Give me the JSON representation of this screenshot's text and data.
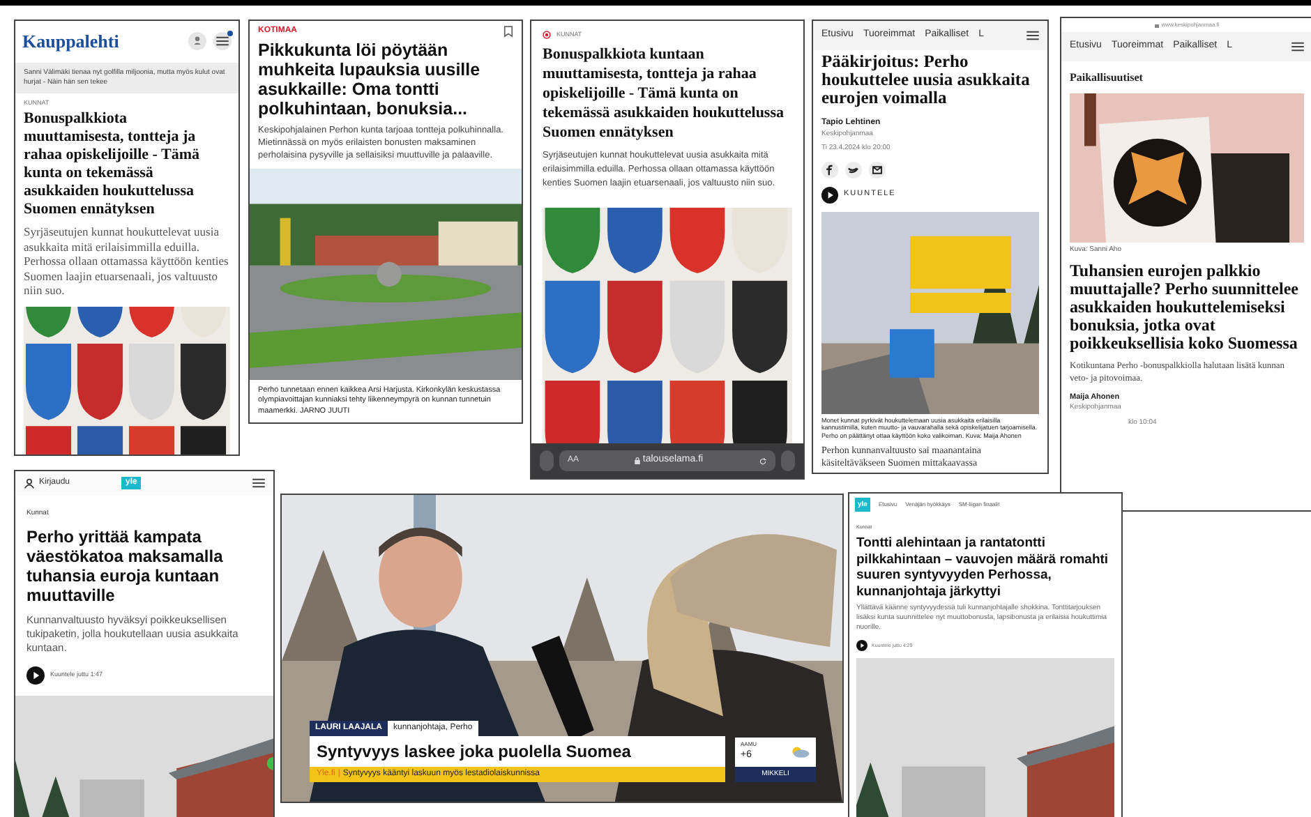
{
  "kauppalehti": {
    "logo": "Kauppalehti",
    "teaser": "Sanni Välimäki tienaa nyt golfilla miljoonia, mutta myös kulut ovat hurjat - Näin hän sen tekee",
    "tag": "KUNNAT",
    "headline": "Bonuspalkkiota muuttamisesta, tontteja ja rahaa opiskelijoille - Tämä kunta on tekemässä asukkaiden houkuttelussa Suomen ennätyksen",
    "lead": "Syrjäseutujen kunnat houkuttelevat uusia asukkaita mitä erilaisimmilla eduilla. Perhossa ollaan ottamassa käyttöön kenties Suomen laajin etuarsenaali, jos valtuusto niin suo."
  },
  "kotimaa": {
    "section": "KOTIMAA",
    "headline": "Pikkukunta löi pöytään muhkeita lupauksia uusille asukkaille: Oma tontti polkuhintaan, bonuksia...",
    "lead": "Keskipohjalainen Perhon kunta tarjoaa tontteja polkuhinnalla. Mietinnässä on myös erilaisten bonusten maksaminen perholaisina pysyville ja sellaisiksi muuttuville ja palaaville.",
    "caption": "Perho tunnetaan ennen kaikkea Arsi Harjusta. Kirkonkylän keskustassa olympiavoittajan kunniaksi tehty liikenneympyrä on kunnan tunnetuin maamerkki. JARNO JUUTI"
  },
  "talouselama": {
    "tag": "KUNNAT",
    "headline": "Bonuspalkkiota kuntaan muuttamisesta, tontteja ja rahaa opiskelijoille - Tämä kunta on tekemässä asukkaiden houkuttelussa Suomen ennätyksen",
    "lead": "Syrjäseutujen kunnat houkuttelevat uusia asukkaita mitä erilaisimmilla eduilla. Perhossa ollaan ottamassa käyttöön kenties Suomen laajin etuarsenaali, jos valtuusto niin suo.",
    "browser": {
      "text_size": "AA",
      "url": "talouselama.fi"
    }
  },
  "paakirjoitus": {
    "nav": [
      "Etusivu",
      "Tuoreimmat",
      "Paikalliset",
      "L"
    ],
    "headline": "Pääkirjoitus: Perho houkuttelee uusia asukkaita eurojen voimalla",
    "author": "Tapio Lehtinen",
    "outlet": "Keskipohjanmaa",
    "date": "Ti 23.4.2024 klo 20:00",
    "listen": "KUUNTELE",
    "caption": "Monet kunnat pyrkivät houkuttelemaan uusia asukkaita erilaisilla kannustimilla, kuten muutto- ja vauvarahalla sekä opiskelijatuen tarjoamisella. Perho on päättänyt ottaa käyttöön koko valikoiman. Kuva: Maija Ahonen",
    "body": "Perhon kunnanvaltuusto sai maanantaina käsiteltäväkseen Suomen mittakaavassa"
  },
  "keskipohjanmaa": {
    "url": "www.keskipohjanmaa.fi",
    "nav": [
      "Etusivu",
      "Tuoreimmat",
      "Paikalliset",
      "L"
    ],
    "section": "Paikallisuutiset",
    "photo_credit": "Kuva: Sanni Aho",
    "headline": "Tuhansien eurojen palkkio muuttajalle? Perho suunnittelee asukkaiden houkuttelemiseksi bonuksia, jotka ovat poikkeuksellisia koko Suomessa",
    "lead": "Kotikuntana Perho -bonuspalkkiolla halutaan lisätä kunnan veto- ja pitovoimaa.",
    "author": "Maija Ahonen",
    "outlet": "Keskipohjanmaa",
    "date": "klo 10:04"
  },
  "yle_mobile": {
    "login": "Kirjaudu",
    "logo": "yle",
    "tag": "Kunnat",
    "headline": "Perho yrittää kampata väestökatoa maksamalla tuhansia euroja kuntaan muuttaville",
    "lead": "Kunnanvaltuusto hyväksyi poikkeuksellisen tukipaketin, jolla houkutellaan uusia asukkaita kuntaan.",
    "listen": "Kuuntele juttu  1:47"
  },
  "video": {
    "name": "LAURI LAAJALA",
    "role": "kunnanjohtaja, Perho",
    "headline": "Syntyvyys laskee joka puolella Suomea",
    "ticker_source": "Yle.fi",
    "ticker_separator": "|",
    "ticker": "Syntyvyys kääntyi laskuun myös lestadiolaiskunnissa",
    "weather": {
      "period": "AAMU",
      "temp": "+6",
      "city": "MIKKELI"
    }
  },
  "yle_desktop": {
    "logo": "yle",
    "nav": [
      "Etusivu",
      "Venäjän hyökkäys",
      "SM-liigan finaalit"
    ],
    "tag": "Kunnat",
    "headline": "Tontti alehintaan ja rantatontti pilkkahintaan – vauvojen määrä romahti suuren syntyvyyden Perhossa, kunnanjohtaja järkyttyi",
    "lead": "Yllättävä käänne syntyvyydessä tuli kunnanjohtajalle shokkina. Tonttitarjouksen lisäksi kunta suunnittelee nyt muuttobonusta, lapsibonusta ja erilaisia houkuttimia nuorille.",
    "listen": "Kuuntele juttu  4:29"
  }
}
